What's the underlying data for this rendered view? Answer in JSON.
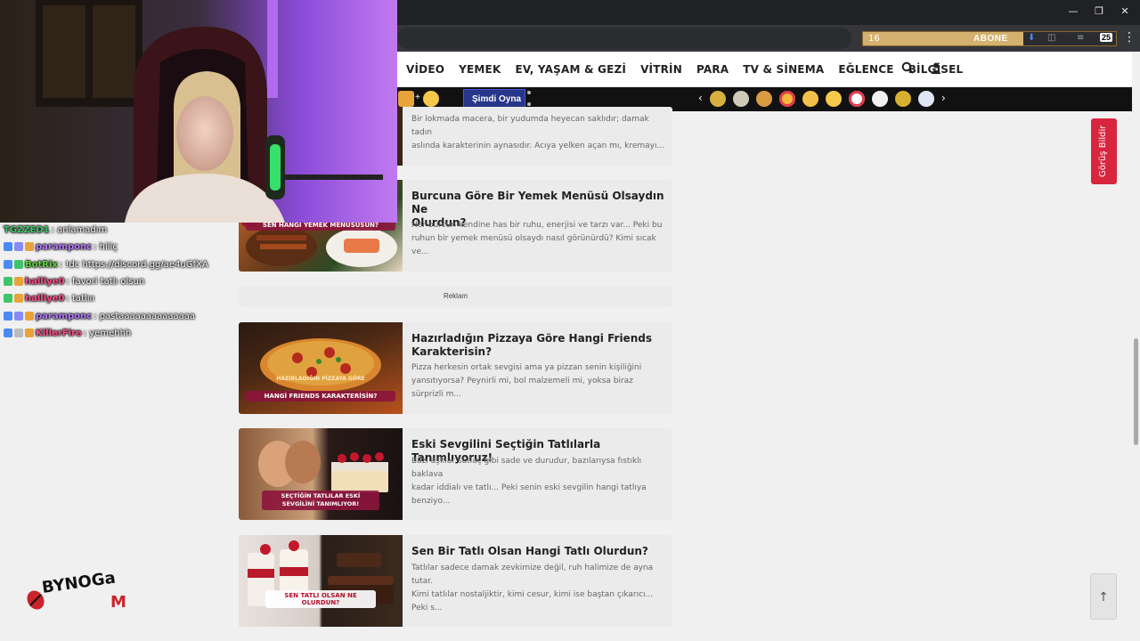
{
  "browser": {
    "ext_left_value": "16",
    "ext_abone_label": "ABONE",
    "ext_count": "25"
  },
  "nav": {
    "items": [
      "VİDEO",
      "YEMEK",
      "EV, YAŞAM & GEZİ",
      "VİTRİN",
      "PARA",
      "TV & SİNEMA",
      "EĞLENCE",
      "BİLGİSEL"
    ]
  },
  "strip": {
    "play_label": "Şimdi Oyna",
    "prev_arrow": "‹",
    "next_arrow": "›"
  },
  "chat": [
    {
      "user": "TGZZED1",
      "text": ": anlamadım",
      "color": "#3fc46a"
    },
    {
      "user": "paramponc",
      "text": ": hiiiç",
      "color": "#b57bff"
    },
    {
      "user": "BotRix",
      "text": ": !dc https://discord.gg/ae4uGfXA",
      "color": "#5bd43a"
    },
    {
      "user": "halliye0",
      "text": ": favori tatlı olsun",
      "color": "#ff4f8b"
    },
    {
      "user": "halliye0",
      "text": ": tatlııı",
      "color": "#ff4f8b"
    },
    {
      "user": "paramponc",
      "text": ": pastaaaaaaaaaaaaaa",
      "color": "#b57bff"
    },
    {
      "user": "KillerFire",
      "text": ": yemehhh",
      "color": "#ff4f8b"
    }
  ],
  "logo_text": "BYNOGaM",
  "articles": [
    {
      "title": "",
      "desc_1": "Bir lokmada macera, bir yudumda heyecan saklıdır; damak tadın",
      "desc_2": "aslında karakterinin aynasıdır. Acıya yelken açan mı, kremayı..."
    },
    {
      "title_1": "Burcuna Göre Bir Yemek Menüsü Olsaydın Ne",
      "title_2": "Olurdun?",
      "desc_1": "Her burcun kendine has bir ruhu, enerjisi ve tarzı var... Peki bu",
      "desc_2": "ruhun bir yemek menüsü olsaydı nasıl görünürdü? Kimi sıcak ve...",
      "thumb_caption": "SEN HANGİ YEMEK MENÜSÜSÜN?"
    },
    {
      "title_1": "Hazırladığın Pizzaya Göre Hangi Friends",
      "title_2": "Karakterisin?",
      "desc_1": "Pizza herkesin ortak sevgisi ama ya pizzan senin kişiliğini",
      "desc_2": "yansıtıyorsa? Peynirli mi, bol malzemeli mi, yoksa biraz sürprizli m...",
      "thumb_caption_1": "HAZIRLADIĞIN PİZZAYA GÖRE",
      "thumb_caption_2": "HANGİ FRIENDS KARAKTERİSİN?"
    },
    {
      "title_1": "Eski Sevgilini Seçtiğin Tatlılarla Tanımlıyoruz!",
      "desc_1": "Bazı aşklar sütlaç gibi sade ve durudur, bazılarıysa fıstıklı baklava",
      "desc_2": "kadar iddialı ve tatlı... Peki senin eski sevgilin hangi tatlıya benziyo...",
      "thumb_caption": "SEÇTİĞİN TATLILAR ESKİ SEVGİLİNİ TANIMLIYOR!"
    },
    {
      "title_1": "Sen Bir Tatlı Olsan Hangi Tatlı Olurdun?",
      "desc_1": "Tatlılar sadece damak zevkimize değil, ruh halimize de ayna tutar.",
      "desc_2": "Kimi tatlılar nostaljiktir, kimi cesur, kimi ise baştan çıkarıcı... Peki s...",
      "thumb_caption": "SEN TATLI OLSAN NE OLURDUN?"
    }
  ],
  "reklam_label": "Reklam",
  "feedback_label": "Görüş Bildir",
  "totop_icon": "↑",
  "colors": {
    "feedback": "#d7263d",
    "play_button": "#26368a",
    "caption_bg": "#8c143c"
  }
}
